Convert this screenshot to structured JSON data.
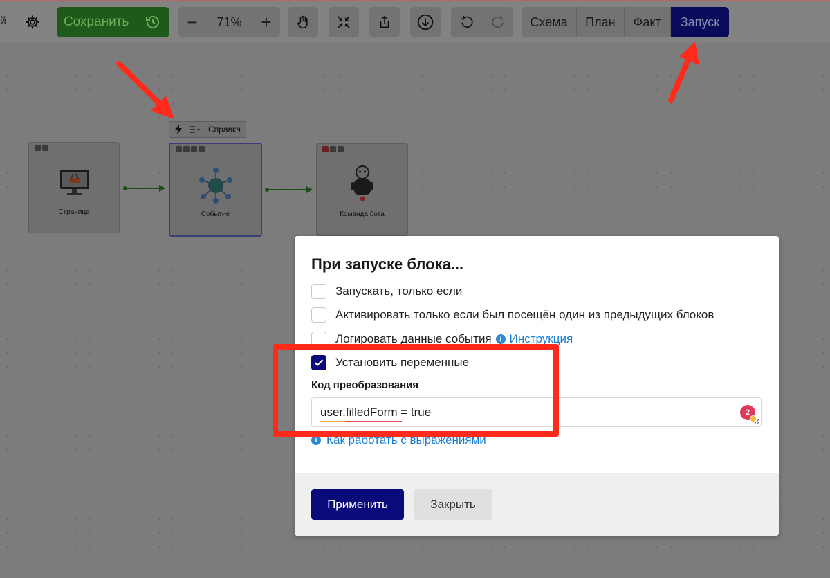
{
  "toolbar": {
    "truncated_text": "й",
    "settings_icon": "gear-icon",
    "save_label": "Сохранить",
    "history_icon": "history-icon",
    "zoom_out": "−",
    "zoom_value": "71%",
    "zoom_in": "+",
    "pan_icon": "hand-icon",
    "fit_icon": "fit-icon",
    "share_icon": "share-icon",
    "download_icon": "download-icon",
    "undo_icon": "undo-icon",
    "redo_icon": "redo-icon",
    "modes": [
      "Схема",
      "План",
      "Факт",
      "Запуск"
    ],
    "active_mode": "Запуск"
  },
  "diagram": {
    "block_toolbar": {
      "bolt_icon": "bolt-icon",
      "list_icon": "list-icon",
      "help_label": "Справка"
    },
    "nodes": [
      {
        "label": "Страница",
        "icon": "monitor-basket-icon"
      },
      {
        "label": "Событие",
        "icon": "hub-network-icon"
      },
      {
        "label": "Команда бота",
        "icon": "robot-icon"
      }
    ]
  },
  "dialog": {
    "title": "При запуске блока...",
    "options": [
      {
        "label": "Запускать, только если",
        "checked": false
      },
      {
        "label": "Активировать только если был посещён один из предыдущих блоков",
        "checked": false
      },
      {
        "label": "Логировать данные события",
        "checked": false,
        "link": "Инструкция"
      },
      {
        "label": "Установить переменные",
        "checked": true
      }
    ],
    "code_label": "Код преобразования",
    "code_value": "user.filledForm = true",
    "badge_count": "2",
    "help_link": "Как работать с выражениями",
    "apply_label": "Применить",
    "close_label": "Закрыть"
  },
  "colors": {
    "accent": "#0a0a7a",
    "link": "#1a7fd4",
    "annotation": "#ff2a1a"
  }
}
